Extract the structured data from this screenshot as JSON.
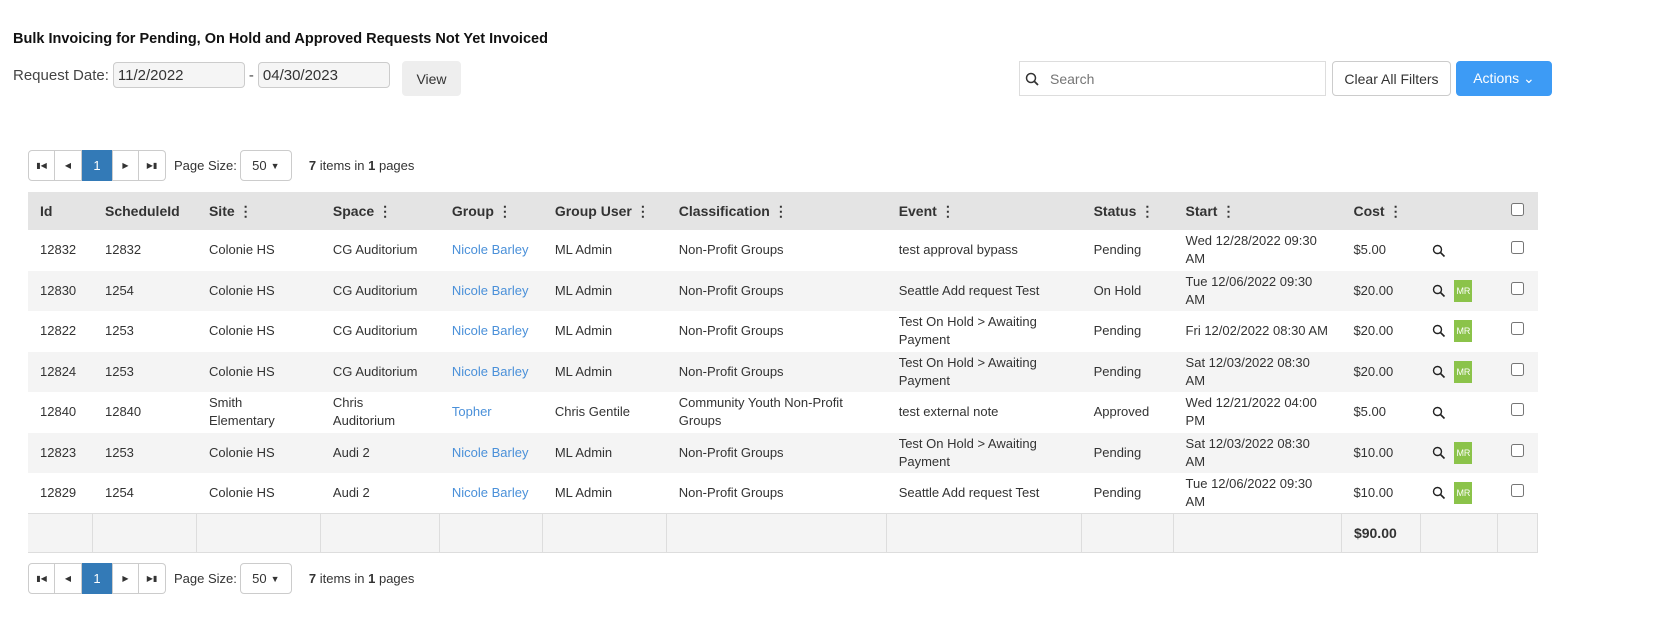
{
  "title": "Bulk Invoicing for Pending, On Hold and Approved Requests Not Yet Invoiced",
  "filters": {
    "date_label": "Request Date:",
    "start_date": "11/2/2022",
    "separator": "-",
    "end_date": "04/30/2023",
    "view_label": "View"
  },
  "search": {
    "placeholder": "Search"
  },
  "toolbar": {
    "clear_label": "Clear All Filters",
    "actions_label": "Actions"
  },
  "pager": {
    "current_page": "1",
    "page_size_label": "Page Size:",
    "page_size": "50",
    "items_count": "7",
    "items_mid": " items in ",
    "pages_count": "1",
    "pages_suffix": " pages"
  },
  "columns": [
    "Id",
    "ScheduleId",
    "Site",
    "Space",
    "Group",
    "Group User",
    "Classification",
    "Event",
    "Status",
    "Start",
    "Cost"
  ],
  "rows": [
    [
      "12832",
      "12832",
      "Colonie HS",
      "CG Auditorium",
      "Nicole Barley",
      "ML Admin",
      "Non-Profit Groups",
      "test approval bypass",
      "Pending",
      "Wed 12/28/2022 09:30 AM",
      "$5.00",
      false
    ],
    [
      "12830",
      "1254",
      "Colonie HS",
      "CG Auditorium",
      "Nicole Barley",
      "ML Admin",
      "Non-Profit Groups",
      "Seattle Add request Test",
      "On Hold",
      "Tue 12/06/2022 09:30 AM",
      "$20.00",
      true
    ],
    [
      "12822",
      "1253",
      "Colonie HS",
      "CG Auditorium",
      "Nicole Barley",
      "ML Admin",
      "Non-Profit Groups",
      "Test On Hold > Awaiting Payment",
      "Pending",
      "Fri 12/02/2022 08:30 AM",
      "$20.00",
      true
    ],
    [
      "12824",
      "1253",
      "Colonie HS",
      "CG Auditorium",
      "Nicole Barley",
      "ML Admin",
      "Non-Profit Groups",
      "Test On Hold > Awaiting Payment",
      "Pending",
      "Sat 12/03/2022 08:30 AM",
      "$20.00",
      true
    ],
    [
      "12840",
      "12840",
      "Smith Elementary",
      "Chris Auditorium",
      "Topher",
      "Chris Gentile",
      "Community Youth Non-Profit Groups",
      "test external note",
      "Approved",
      "Wed 12/21/2022 04:00 PM",
      "$5.00",
      false
    ],
    [
      "12823",
      "1253",
      "Colonie HS",
      "Audi 2",
      "Nicole Barley",
      "ML Admin",
      "Non-Profit Groups",
      "Test On Hold > Awaiting Payment",
      "Pending",
      "Sat 12/03/2022 08:30 AM",
      "$10.00",
      true
    ],
    [
      "12829",
      "1254",
      "Colonie HS",
      "Audi 2",
      "Nicole Barley",
      "ML Admin",
      "Non-Profit Groups",
      "Seattle Add request Test",
      "Pending",
      "Tue 12/06/2022 09:30 AM",
      "$10.00",
      true
    ]
  ],
  "mr_label": "MR",
  "total_cost": "$90.00"
}
